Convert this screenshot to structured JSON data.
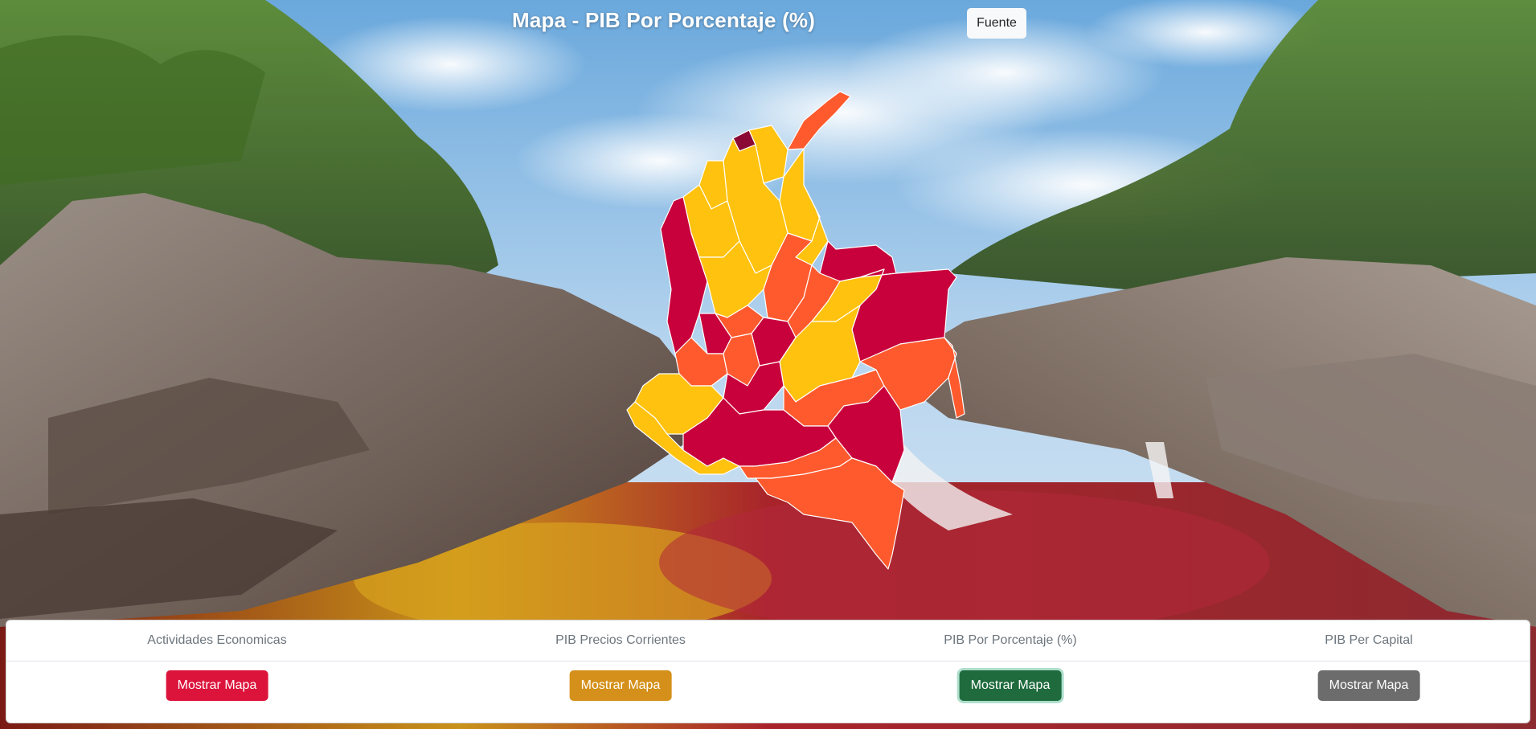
{
  "header": {
    "title": "Mapa - PIB Por Porcentaje (%)",
    "source_button_label": "Fuente"
  },
  "colors": {
    "sky": "#7fb6e0",
    "map_red": "#c8003c",
    "map_orange": "#ff5a2e",
    "map_yellow": "#ffc20e",
    "map_dark": "#8a0a35",
    "btn_red": "#dc143c",
    "btn_gold": "#d4901a",
    "btn_green": "#1f6b3d",
    "btn_gray": "#6c6c6c"
  },
  "map": {
    "icon": "colombia-departments-choropleth"
  },
  "panel": {
    "sections": [
      {
        "label": "Actividades Economicas",
        "button_label": "Mostrar Mapa"
      },
      {
        "label": "PIB Precios Corrientes",
        "button_label": "Mostrar Mapa"
      },
      {
        "label": "PIB Por Porcentaje (%)",
        "button_label": "Mostrar Mapa"
      },
      {
        "label": "PIB Per Capital",
        "button_label": "Mostrar Mapa"
      }
    ]
  }
}
